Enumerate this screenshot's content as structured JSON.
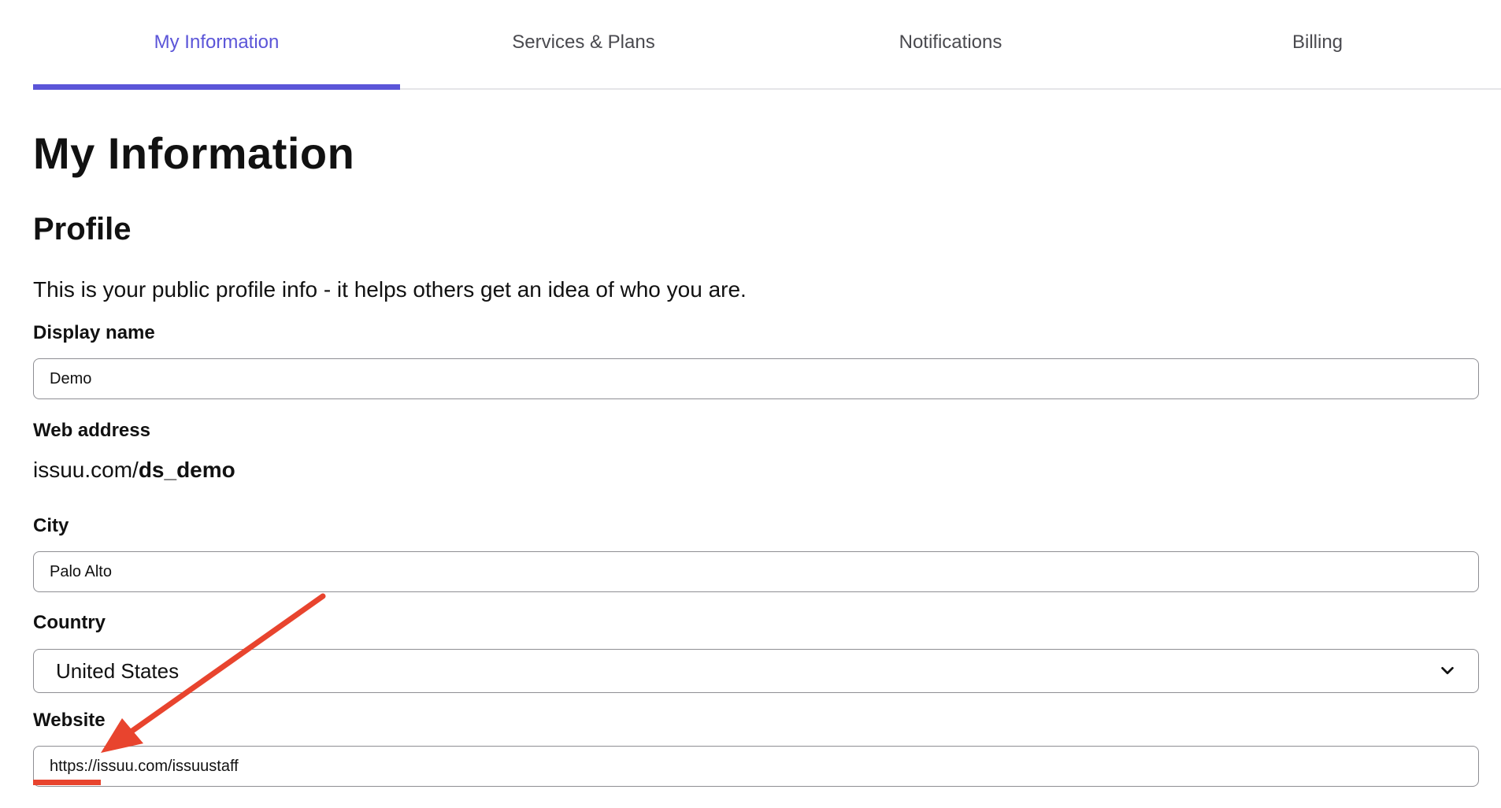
{
  "tabs": [
    {
      "label": "My Information",
      "active": true
    },
    {
      "label": "Services & Plans",
      "active": false
    },
    {
      "label": "Notifications",
      "active": false
    },
    {
      "label": "Billing",
      "active": false
    }
  ],
  "page": {
    "title": "My Information"
  },
  "profile": {
    "heading": "Profile",
    "description": "This is your public profile info - it helps others get an idea of who you are.",
    "display_name": {
      "label": "Display name",
      "value": "Demo"
    },
    "web_address": {
      "label": "Web address",
      "prefix": "issuu.com/",
      "handle": "ds_demo"
    },
    "city": {
      "label": "City",
      "value": "Palo Alto"
    },
    "country": {
      "label": "Country",
      "value": "United States"
    },
    "website": {
      "label": "Website",
      "value": "https://issuu.com/issuustaff"
    }
  },
  "colors": {
    "accent": "#5b55d8",
    "annotation": "#e8442e",
    "border": "#8e8e93"
  },
  "icons": {
    "country_dropdown": "chevron-down-icon"
  }
}
